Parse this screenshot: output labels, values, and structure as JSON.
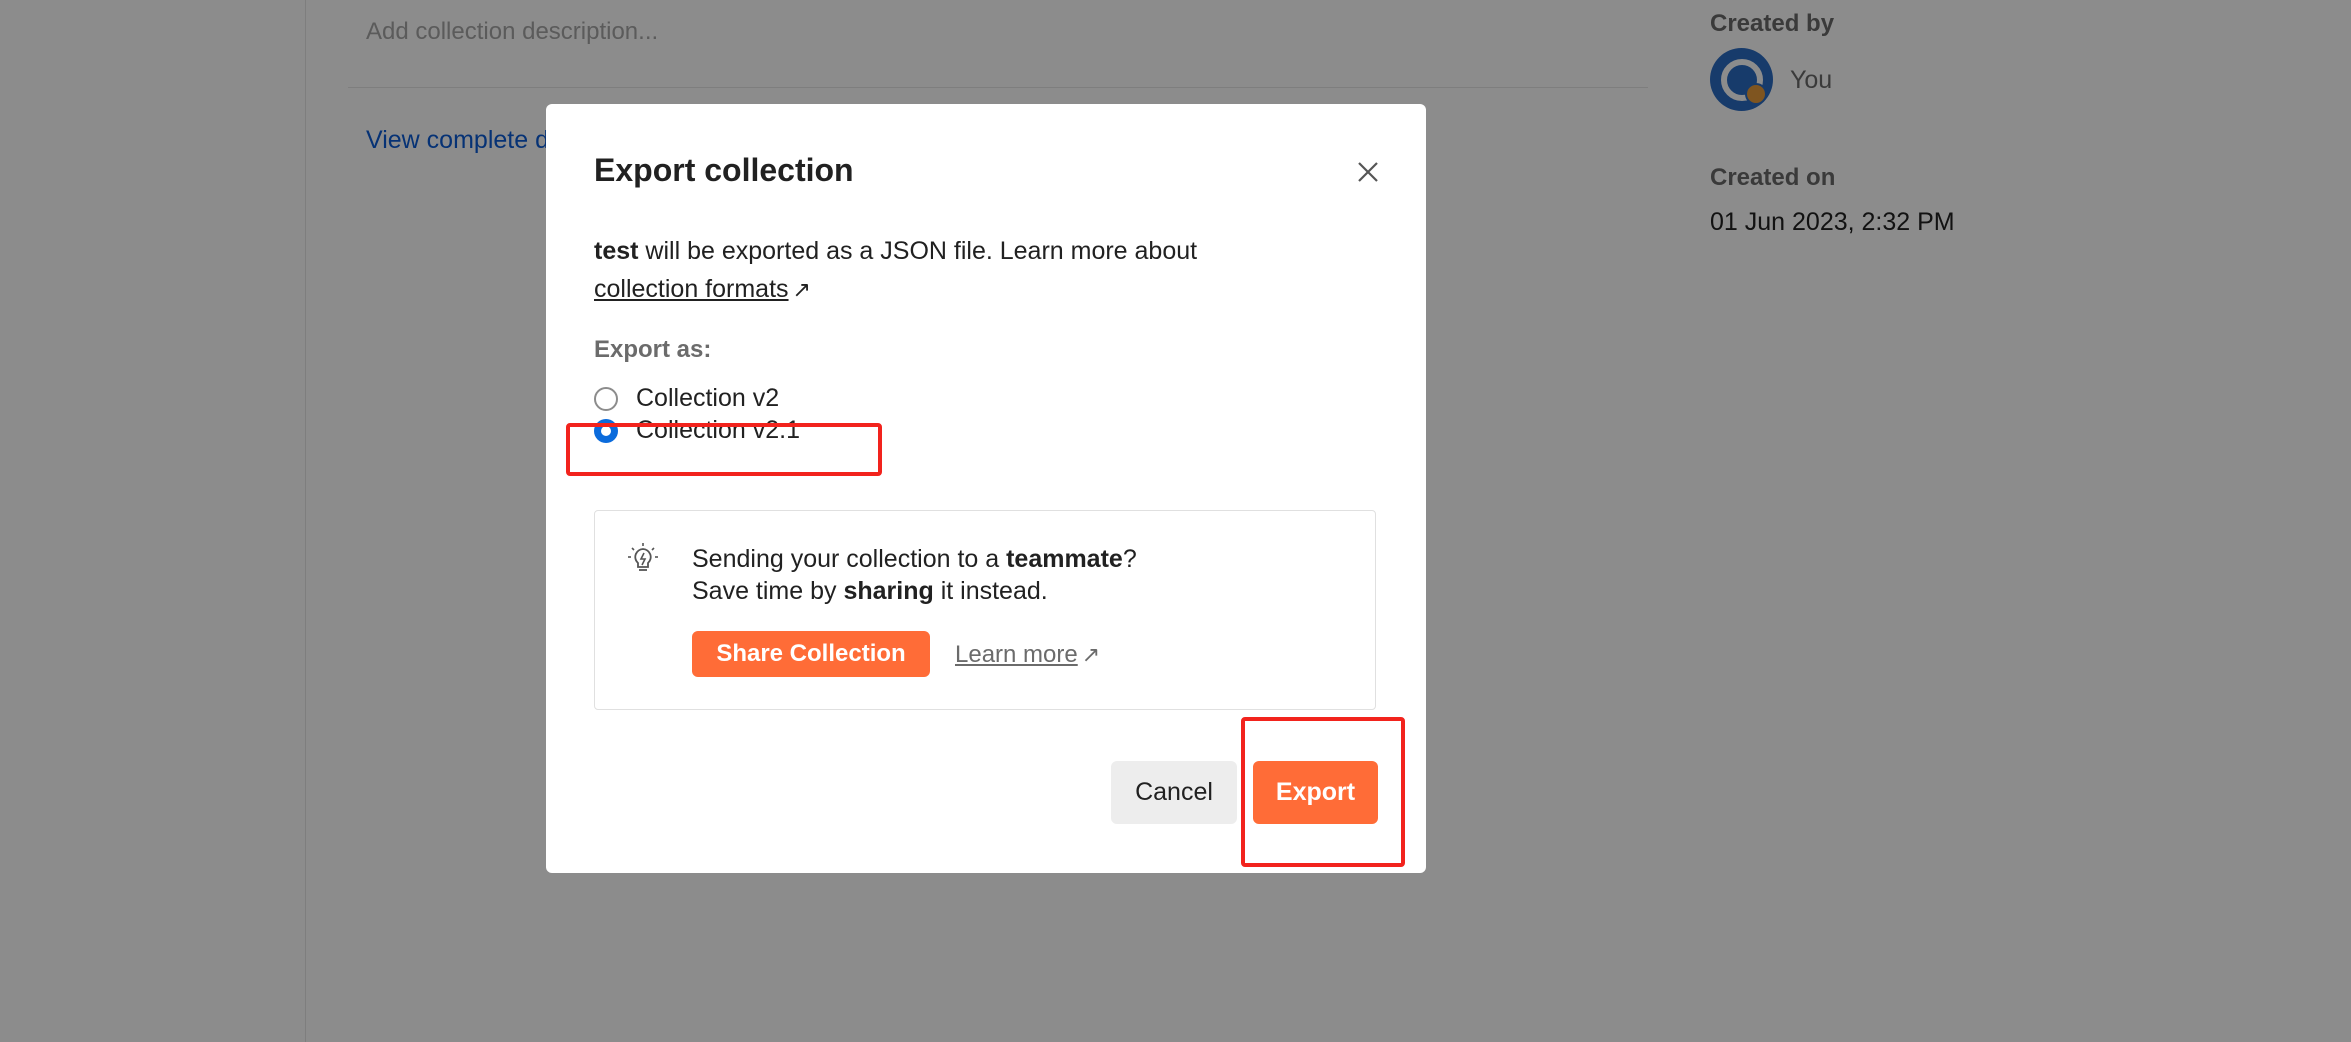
{
  "background": {
    "description_placeholder": "Add collection description...",
    "view_complete_link": "View complete d",
    "created_by_label": "Created by",
    "created_by_value": "You",
    "created_on_label": "Created on",
    "created_on_value": "01 Jun 2023, 2:32 PM"
  },
  "modal": {
    "title": "Export collection",
    "intro_name": "test",
    "intro_text": " will be exported as a JSON file. Learn more about",
    "formats_link": "collection formats",
    "arrow": "↗",
    "export_as_label": "Export as:",
    "options": [
      {
        "label": "Collection v2",
        "checked": false
      },
      {
        "label": "Collection v2.1",
        "checked": true
      }
    ],
    "tip": {
      "line1_prefix": "Sending your collection to a ",
      "line1_bold": "teammate",
      "line1_suffix": "?",
      "line2_prefix": "Save time by ",
      "line2_bold": "sharing",
      "line2_suffix": " it instead.",
      "share_button": "Share Collection",
      "learn_more": "Learn more"
    },
    "cancel_button": "Cancel",
    "export_button": "Export"
  },
  "colors": {
    "accent": "#ff6c37",
    "radio_selected": "#0b6bdc",
    "highlight": "#f2231d",
    "link": "#0b5cd5"
  }
}
